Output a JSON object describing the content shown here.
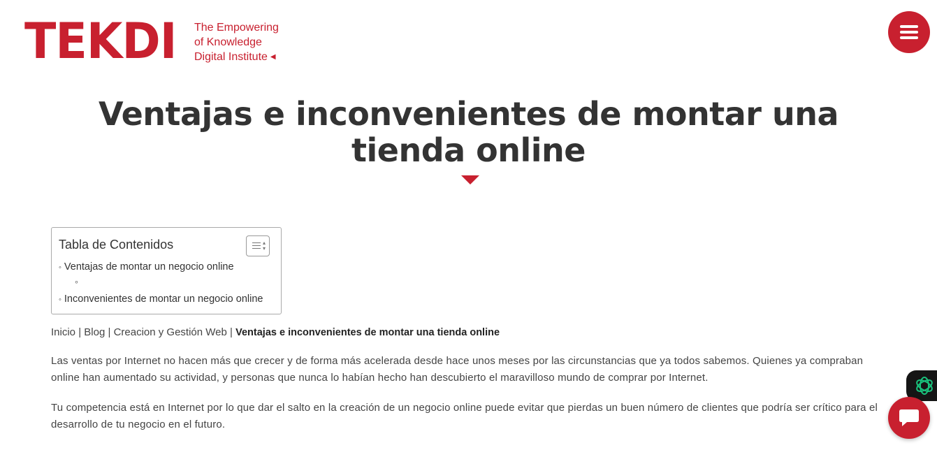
{
  "header": {
    "logo_text": "TEKDI",
    "tagline": [
      "The Empowering",
      "of Knowledge",
      "Digital Institute"
    ],
    "menu_icon": "hamburger-icon"
  },
  "article": {
    "title": "Ventajas e inconvenientes de montar una tienda online",
    "paragraphs": [
      "Las ventas por Internet no hacen más que crecer y de forma más acelerada desde hace unos meses por las circunstancias que ya todos sabemos. Quienes ya compraban online han aumentado su actividad, y personas que nunca lo habían hecho han descubierto el maravilloso mundo de comprar por Internet.",
      "Tu competencia está en Internet por lo que dar el salto en la creación de un negocio online puede evitar que pierdas un buen número de clientes que podría ser crítico para el desarrollo de tu negocio en el futuro."
    ]
  },
  "toc": {
    "title": "Tabla de Contenidos",
    "items": [
      "Ventajas de montar un negocio online",
      "Inconvenientes de montar un negocio online"
    ],
    "sub_marker": "∘",
    "bullet": "◦"
  },
  "breadcrumb": {
    "items": [
      "Inicio",
      "Blog",
      "Creacion y Gestión Web"
    ],
    "separator": "|",
    "current": "Ventajas e inconvenientes de montar una tienda online"
  },
  "widgets": {
    "ai_icon": "ai-knot-icon",
    "chat_icon": "chat-bubble-icon"
  },
  "colors": {
    "brand": "#c8202f",
    "text": "#333333",
    "ai_tab_bg": "#151515",
    "ai_icon": "#19c37d"
  }
}
